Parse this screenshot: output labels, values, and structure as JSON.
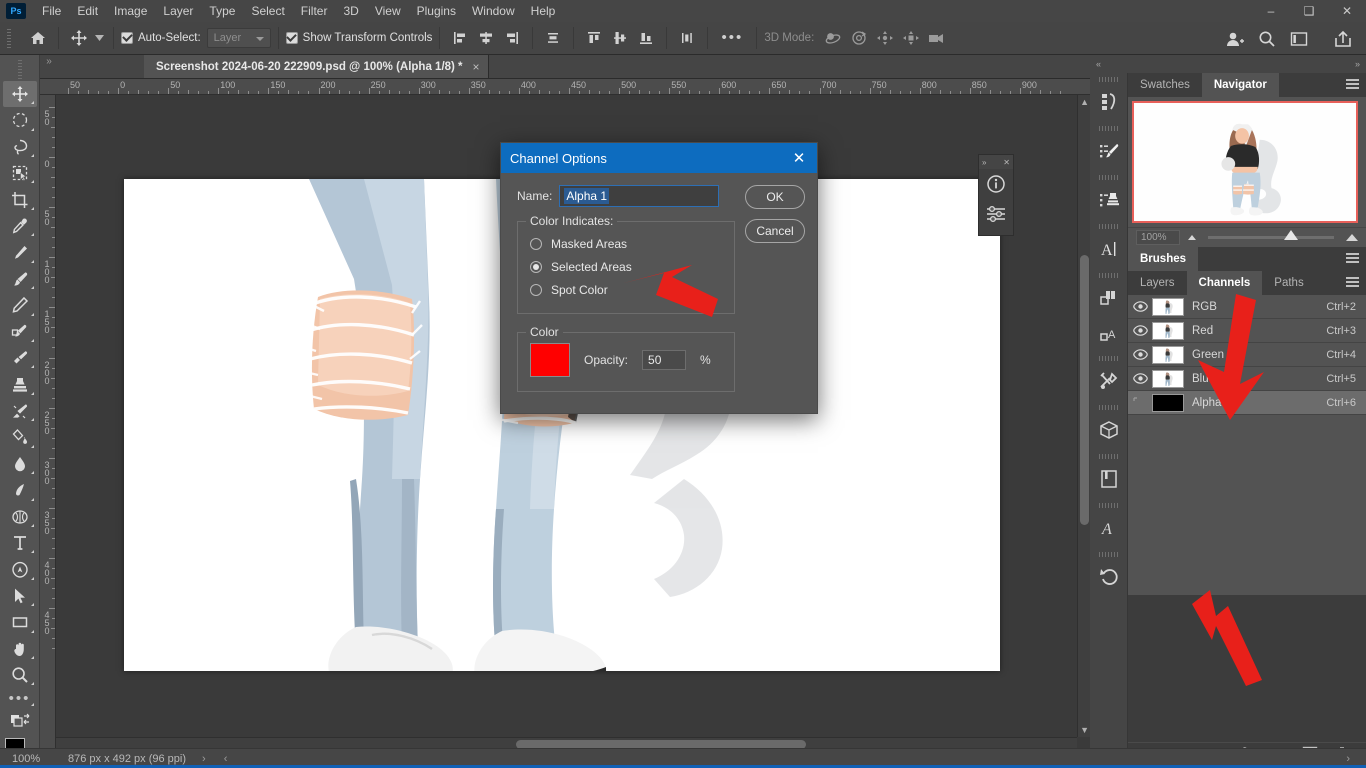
{
  "app": {
    "name": "Adobe Photoshop",
    "logo_text": "Ps",
    "accent_color": "#0d6cbf",
    "annotation_color": "#e8201a"
  },
  "menubar": {
    "items": [
      "File",
      "Edit",
      "Image",
      "Layer",
      "Type",
      "Select",
      "Filter",
      "3D",
      "View",
      "Plugins",
      "Window",
      "Help"
    ],
    "window_controls": [
      "minimize-icon",
      "maximize-icon",
      "close-icon"
    ]
  },
  "options_bar": {
    "home_icon": "home-icon",
    "tool_icon": "move-tool-icon",
    "auto_select_label": "Auto-Select:",
    "auto_select_checked": true,
    "layer_select_value": "Layer",
    "show_transform_label": "Show Transform Controls",
    "show_transform_checked": true,
    "align_icons": [
      "align-left-edges-icon",
      "align-horizontal-centers-icon",
      "align-right-edges-icon",
      "align-top-edges-icon",
      "align-vertical-centers-icon",
      "align-bottom-edges-icon",
      "distribute-icon"
    ],
    "more_label": "•••",
    "three_d_label": "3D Mode:",
    "three_d_icons": [
      "3d-orbit-icon",
      "3d-roll-icon",
      "3d-pan-icon",
      "3d-slide-icon",
      "3d-camera-icon"
    ],
    "right_icons": [
      "share-user-icon",
      "search-icon",
      "workspace-icon",
      "export-share-icon"
    ]
  },
  "toolbar": {
    "tools": [
      {
        "name": "move-tool",
        "selected": true
      },
      {
        "name": "elliptical-marquee-tool",
        "selected": false
      },
      {
        "name": "lasso-tool",
        "selected": false
      },
      {
        "name": "object-selection-tool",
        "selected": false
      },
      {
        "name": "crop-tool",
        "selected": false
      },
      {
        "name": "eyedropper-tool",
        "selected": false
      },
      {
        "name": "healing-brush-tool",
        "selected": false
      },
      {
        "name": "brush-tool",
        "selected": false
      },
      {
        "name": "clone-stamp-tool",
        "selected": false
      },
      {
        "name": "history-brush-tool",
        "selected": false
      },
      {
        "name": "eraser-tool",
        "selected": false
      },
      {
        "name": "gradient-tool",
        "selected": false
      },
      {
        "name": "blur-tool",
        "selected": false
      },
      {
        "name": "dodge-tool",
        "selected": false
      },
      {
        "name": "neural-filters-tool",
        "selected": false
      },
      {
        "name": "type-tool",
        "selected": false
      },
      {
        "name": "pen-tool",
        "selected": false
      },
      {
        "name": "path-selection-tool",
        "selected": false
      },
      {
        "name": "rectangle-tool",
        "selected": false
      },
      {
        "name": "hand-tool",
        "selected": false
      },
      {
        "name": "zoom-tool",
        "selected": false
      },
      {
        "name": "edit-toolbar-tool",
        "selected": false
      }
    ],
    "foreground_color": "#000000",
    "background_color": "#ffffff"
  },
  "document_tab": {
    "title": "Screenshot 2024-06-20 222909.psd @ 100% (Alpha 1/8) *",
    "close_label": "×"
  },
  "rulers": {
    "unit": "px",
    "top_ticks": [
      "50",
      "0",
      "50",
      "100",
      "150",
      "200",
      "250",
      "300",
      "350",
      "400",
      "450",
      "500",
      "550",
      "600",
      "650",
      "700",
      "750",
      "800",
      "850",
      "900"
    ],
    "left_ticks": [
      "50",
      "0",
      "50",
      "100",
      "150",
      "200",
      "250",
      "300",
      "350",
      "400",
      "450"
    ]
  },
  "dialog": {
    "title": "Channel Options",
    "close_label": "✕",
    "name_label": "Name:",
    "name_value": "Alpha 1",
    "ok_label": "OK",
    "cancel_label": "Cancel",
    "color_indicates_label": "Color Indicates:",
    "options": [
      {
        "label": "Masked Areas",
        "selected": false
      },
      {
        "label": "Selected Areas",
        "selected": true
      },
      {
        "label": "Spot Color",
        "selected": false
      }
    ],
    "color_group_label": "Color",
    "color_swatch": "#ff0000",
    "opacity_label": "Opacity:",
    "opacity_value": "50",
    "percent_label": "%"
  },
  "mini_panel": {
    "icons": [
      "info-icon",
      "properties-adjustments-icon"
    ],
    "expand_label": "»",
    "close_label": "✕"
  },
  "right_dock": {
    "icons": [
      "libraries-icon",
      "brush-settings-icon",
      "clone-source-icon",
      "character-icon",
      "layer-comps-icon",
      "paragraph-styles-icon",
      "tool-presets-icon",
      "3d-icon",
      "notes-icon",
      "glyphs-icon",
      "history-icon"
    ]
  },
  "navigator_panel": {
    "dock_collapse_left": "«",
    "dock_collapse_right": "»",
    "tabs": [
      {
        "label": "Swatches",
        "active": false
      },
      {
        "label": "Navigator",
        "active": true
      }
    ],
    "zoom_value": "100%",
    "menu_icon": "panel-menu-icon"
  },
  "brushes_panel": {
    "tabs": [
      {
        "label": "Brushes",
        "active": true
      }
    ],
    "menu_icon": "panel-menu-icon"
  },
  "channels_panel": {
    "tabs": [
      {
        "label": "Layers",
        "active": false
      },
      {
        "label": "Channels",
        "active": true
      },
      {
        "label": "Paths",
        "active": false
      }
    ],
    "menu_icon": "panel-menu-icon",
    "rows": [
      {
        "name": "RGB",
        "shortcut": "Ctrl+2",
        "visible": true,
        "selected": false,
        "thumb": "composite"
      },
      {
        "name": "Red",
        "shortcut": "Ctrl+3",
        "visible": true,
        "selected": false,
        "thumb": "composite"
      },
      {
        "name": "Green",
        "shortcut": "Ctrl+4",
        "visible": true,
        "selected": false,
        "thumb": "composite"
      },
      {
        "name": "Blue",
        "shortcut": "Ctrl+5",
        "visible": true,
        "selected": false,
        "thumb": "composite"
      },
      {
        "name": "Alpha 1",
        "shortcut": "Ctrl+6",
        "visible": false,
        "selected": true,
        "thumb": "alpha"
      }
    ],
    "footer_icons": [
      "load-channel-as-selection-icon",
      "save-selection-as-channel-icon",
      "create-new-channel-icon",
      "delete-channel-icon"
    ]
  },
  "status_bar": {
    "zoom": "100%",
    "doc_size": "876 px x 492 px (96 ppi)",
    "next_arrow": "›",
    "prev_arrow": "‹"
  },
  "annotations": [
    {
      "name": "arrow-pointing-to-selected-areas",
      "target": "Selected Areas radio"
    },
    {
      "name": "arrow-pointing-to-channels-tab",
      "target": "Channels tab"
    },
    {
      "name": "arrow-pointing-to-alpha-1-channel",
      "target": "Alpha 1 channel row"
    }
  ]
}
